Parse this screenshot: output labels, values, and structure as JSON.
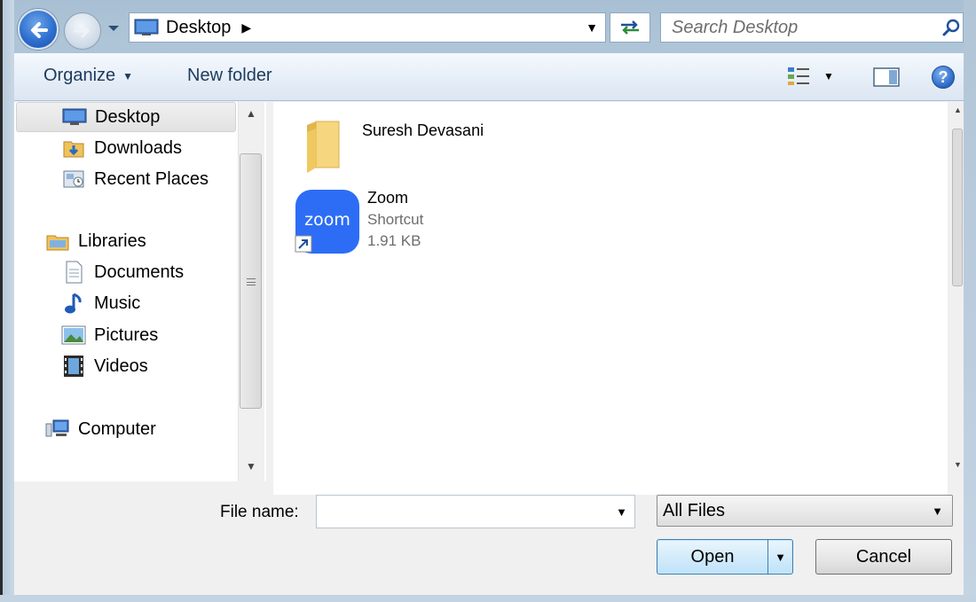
{
  "address": {
    "location": "Desktop",
    "search_placeholder": "Search Desktop"
  },
  "toolbar": {
    "organize_label": "Organize",
    "new_folder_label": "New folder"
  },
  "navigation": {
    "items": [
      {
        "label": "Desktop",
        "icon": "desktop-icon",
        "selected": true
      },
      {
        "label": "Downloads",
        "icon": "downloads-icon"
      },
      {
        "label": "Recent Places",
        "icon": "recent-places-icon"
      },
      {
        "label": "Libraries",
        "icon": "libraries-icon"
      },
      {
        "label": "Documents",
        "icon": "documents-icon"
      },
      {
        "label": "Music",
        "icon": "music-icon"
      },
      {
        "label": "Pictures",
        "icon": "pictures-icon"
      },
      {
        "label": "Videos",
        "icon": "videos-icon"
      },
      {
        "label": "Computer",
        "icon": "computer-icon"
      }
    ]
  },
  "files": [
    {
      "name": "Suresh Devasani",
      "icon": "folder-icon"
    },
    {
      "name": "Zoom",
      "type": "Shortcut",
      "size": "1.91 KB",
      "icon": "zoom-shortcut-icon",
      "icon_text": "zoom",
      "icon_color": "#2d6df6"
    }
  ],
  "bottom": {
    "file_name_label": "File name:",
    "file_name_value": "",
    "file_type": "All Files",
    "open_label": "Open",
    "cancel_label": "Cancel"
  },
  "colors": {
    "accent": "#2e6fd0",
    "zoom_blue": "#2d6df6"
  }
}
